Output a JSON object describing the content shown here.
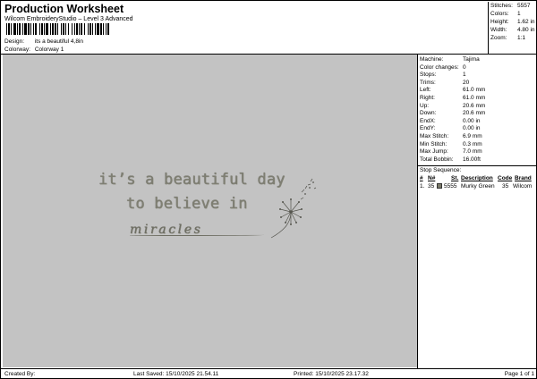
{
  "header": {
    "title": "Production Worksheet",
    "subtitle": "Wilcom EmbroideryStudio – Level 3 Advanced",
    "design_label": "Design:",
    "design_value": "its a beautiful 4,8in",
    "colorway_label": "Colorway:",
    "colorway_value": "Colorway 1"
  },
  "stats": [
    {
      "label": "Stitches:",
      "value": "5557"
    },
    {
      "label": "Colors:",
      "value": "1"
    },
    {
      "label": "Height:",
      "value": "1.62 in"
    },
    {
      "label": "Width:",
      "value": "4.80 in"
    },
    {
      "label": "Zoom:",
      "value": "1:1"
    }
  ],
  "design_text": {
    "line1": "it’s a beautiful day",
    "line2": "to believe in",
    "line3": "miracles",
    "thread_color": "#7f7f73"
  },
  "preview_bg": "#c3c3c3",
  "machine_info": [
    {
      "label": "Machine:",
      "value": "Tajima"
    },
    {
      "label": "Color changes:",
      "value": "0"
    },
    {
      "label": "Stops:",
      "value": "1"
    },
    {
      "label": "Trims:",
      "value": "20"
    },
    {
      "label": "Left:",
      "value": "61.0 mm"
    },
    {
      "label": "Right:",
      "value": "61.0 mm"
    },
    {
      "label": "Up:",
      "value": "20.6 mm"
    },
    {
      "label": "Down:",
      "value": "20.6 mm"
    },
    {
      "label": "EndX:",
      "value": "0.00 in"
    },
    {
      "label": "EndY:",
      "value": "0.00 in"
    },
    {
      "label": "Max Stitch:",
      "value": "6.9 mm"
    },
    {
      "label": "Min Stitch:",
      "value": "0.3 mm"
    },
    {
      "label": "Max Jump:",
      "value": "7.0 mm"
    },
    {
      "label": "Total Bobbin:",
      "value": "16.00ft"
    }
  ],
  "stop_sequence": {
    "title": "Stop Sequence:",
    "headers": {
      "num": "#",
      "n": "N#",
      "st": "St.",
      "description": "Description",
      "code": "Code",
      "brand": "Brand"
    },
    "rows": [
      {
        "num": "1.",
        "n": "35",
        "st": "5555",
        "description": "Murky Green",
        "code": "35",
        "brand": "Wilcom",
        "swatch_color": "#7a7a6a"
      }
    ]
  },
  "footer": {
    "created_by": "Created By:",
    "last_saved": "Last Saved: 15/10/2025 21.54.11",
    "printed": "Printed: 15/10/2025 23.17.32",
    "page": "Page 1 of 1"
  }
}
